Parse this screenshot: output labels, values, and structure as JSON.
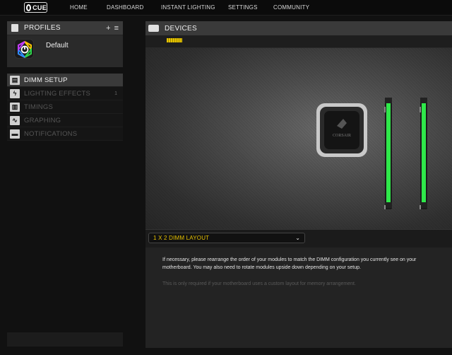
{
  "app": {
    "logo_text": "CUE",
    "nav": [
      {
        "label": "HOME"
      },
      {
        "label": "DASHBOARD"
      },
      {
        "label": "INSTANT LIGHTING"
      },
      {
        "label": "SETTINGS"
      },
      {
        "label": "COMMUNITY"
      }
    ]
  },
  "profiles": {
    "title": "PROFILES",
    "add_label": "+",
    "menu_label": "≡",
    "active_profile": "Default"
  },
  "menu": {
    "items": [
      {
        "label": "DIMM SETUP",
        "icon": "memory-icon",
        "active": true
      },
      {
        "label": "LIGHTING EFFECTS",
        "icon": "lightning-icon",
        "badge": "1"
      },
      {
        "label": "TIMINGS",
        "icon": "timings-icon"
      },
      {
        "label": "GRAPHING",
        "icon": "graph-icon"
      },
      {
        "label": "NOTIFICATIONS",
        "icon": "notification-icon"
      }
    ]
  },
  "devices": {
    "title": "DEVICES"
  },
  "stage": {
    "cooler_brand": "CORSAIR",
    "ram_color": "#2fe84a"
  },
  "layout": {
    "selected": "1 X 2 DIMM LAYOUT"
  },
  "info": {
    "paragraph1": "If necessary, please rearrange the order of your modules to match the DIMM configuration you currently see on your motherboard. You may also need to rotate modules upside down depending on your setup.",
    "paragraph2": "This is only required if your motherboard uses a custom layout for memory arrangement."
  },
  "colors": {
    "accent": "#e8c200",
    "panel_header": "#3a3a3a"
  }
}
